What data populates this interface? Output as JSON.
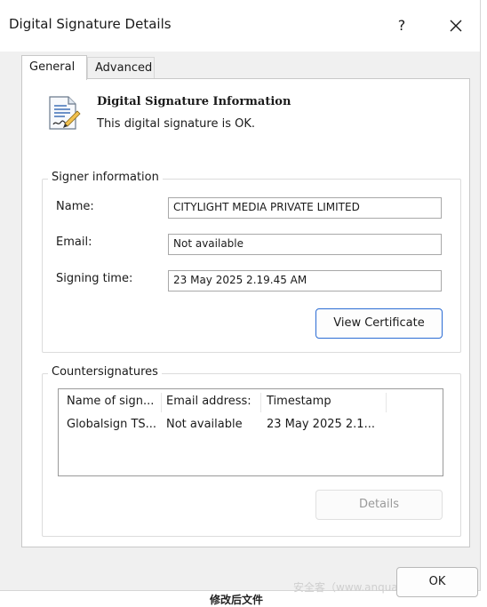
{
  "window": {
    "title": "Digital Signature Details",
    "help_label": "?"
  },
  "tabs": [
    {
      "label": "General",
      "active": true
    },
    {
      "label": "Advanced",
      "active": false
    }
  ],
  "info": {
    "title": "Digital Signature Information",
    "status": "This digital signature is OK.",
    "icon": "signed-document-icon"
  },
  "signer": {
    "legend": "Signer information",
    "name_label": "Name:",
    "name_value": "CITYLIGHT MEDIA PRIVATE LIMITED",
    "email_label": "Email:",
    "email_value": "Not available",
    "time_label": "Signing time:",
    "time_value": "23 May 2025 2.19.45 AM",
    "view_cert_label": "View Certificate"
  },
  "countersignatures": {
    "legend": "Countersignatures",
    "columns": [
      "Name of sign...",
      "Email address:",
      "Timestamp"
    ],
    "rows": [
      [
        "Globalsign TS...",
        "Not available",
        "23 May 2025 2.1..."
      ]
    ],
    "details_label": "Details"
  },
  "footer": {
    "ok_label": "OK",
    "watermark": "安全客（www.anquanke.com）",
    "caption": "修改后文件"
  },
  "colors": {
    "accent_border": "#2b6cd4",
    "window_bg": "#f0f0f0"
  }
}
